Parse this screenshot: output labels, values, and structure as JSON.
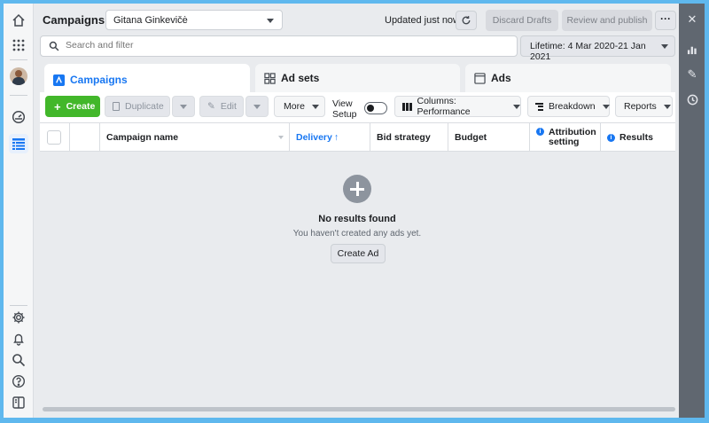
{
  "header": {
    "title": "Campaigns",
    "account": "Gitana Ginkevičė",
    "updated": "Updated just now",
    "discard": "Discard Drafts",
    "review": "Review and publish",
    "more": "···"
  },
  "search": {
    "placeholder": "Search and filter"
  },
  "date_range": "Lifetime: 4 Mar 2020-21 Jan 2021",
  "tabs": [
    {
      "label": "Campaigns",
      "active": true
    },
    {
      "label": "Ad sets",
      "active": false
    },
    {
      "label": "Ads",
      "active": false
    }
  ],
  "toolbar": {
    "create": "Create",
    "duplicate": "Duplicate",
    "edit": "Edit",
    "more": "More",
    "view_setup": [
      "View",
      "Setup"
    ],
    "columns": "Columns: Performance",
    "breakdown": "Breakdown",
    "reports": "Reports"
  },
  "table": {
    "columns": [
      "Campaign name",
      "Delivery",
      "Bid strategy",
      "Budget",
      "Attribution setting",
      "Results"
    ],
    "sorted_column": "Delivery",
    "sort_direction": "ascending"
  },
  "empty_state": {
    "title": "No results found",
    "subtitle": "You haven't created any ads yet.",
    "button": "Create Ad"
  },
  "colors": {
    "accent": "#1877f2",
    "create": "#42b72a",
    "frame": "#5fb8ee",
    "right_panel": "#606770"
  }
}
